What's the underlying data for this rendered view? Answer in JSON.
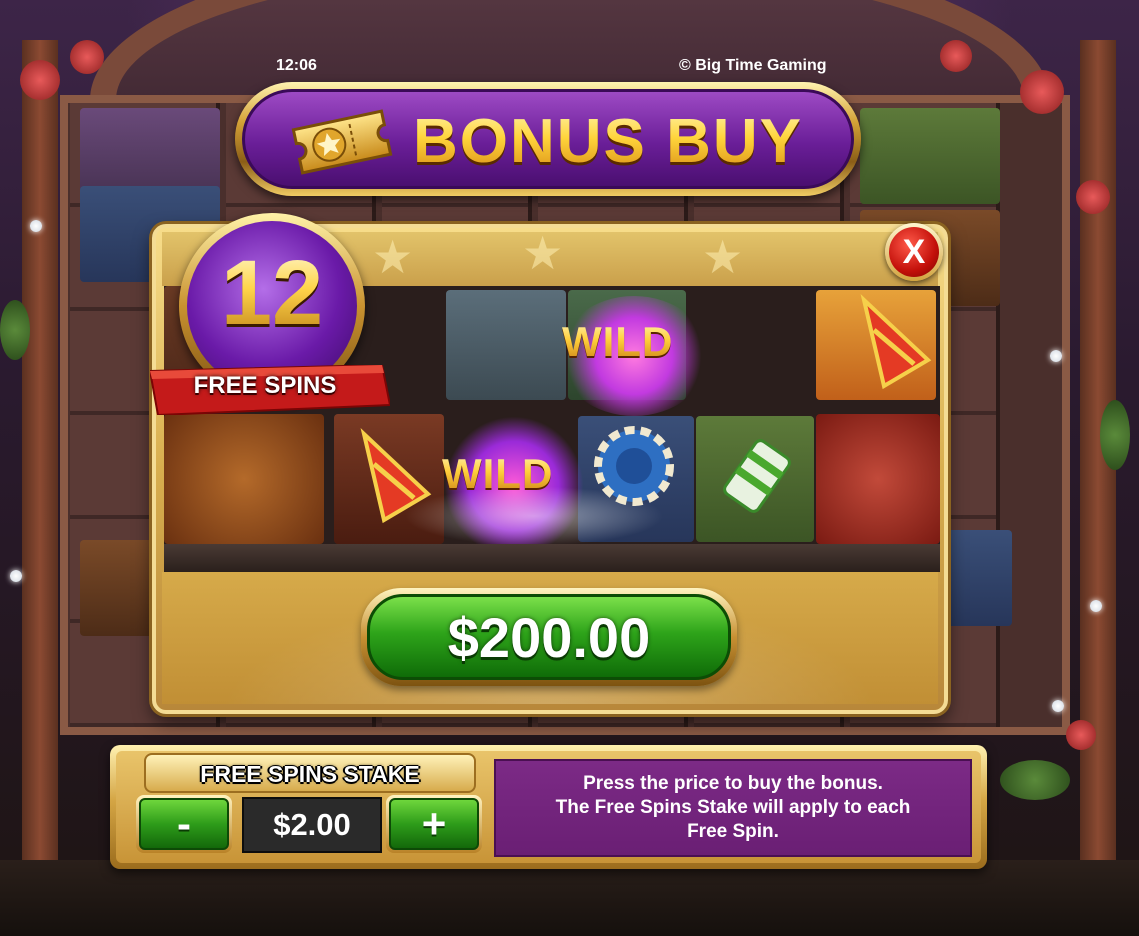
{
  "status_bar": {
    "time": "12:06",
    "copyright": "© Big Time Gaming"
  },
  "banner": {
    "title": "BONUS BUY",
    "icon": "ticket-star-icon"
  },
  "modal": {
    "free_spins_count": "12",
    "free_spins_label": "FREE SPINS",
    "close_label": "X",
    "preview_symbols": [
      "WILD",
      "WILD"
    ],
    "price": "$200.00"
  },
  "stake": {
    "title": "FREE SPINS STAKE",
    "minus_label": "-",
    "plus_label": "+",
    "value": "$2.00"
  },
  "info": {
    "line1": "Press the price to buy the bonus.",
    "line2": "The Free Spins Stake will apply to each",
    "line3": "Free Spin."
  },
  "colors": {
    "gold": "#d4a237",
    "purple": "#6a1e98",
    "green": "#2ea41a",
    "red": "#c3100a",
    "info_purple": "#6a1f74"
  }
}
